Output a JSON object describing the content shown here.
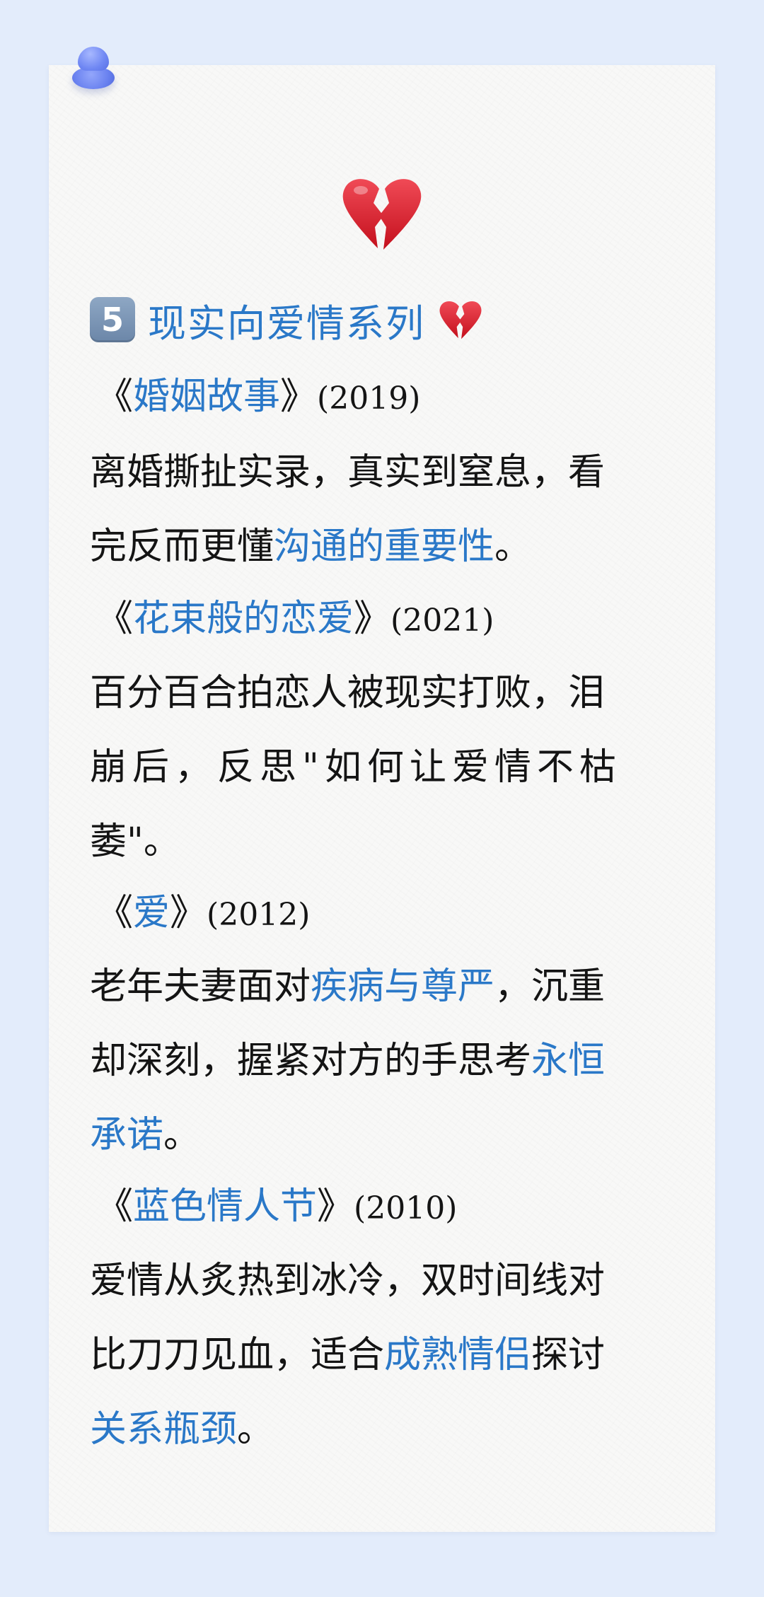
{
  "heading": {
    "number_badge": "5",
    "text": "现实向爱情系列",
    "emoji": "broken-heart"
  },
  "big_emoji": "broken-heart",
  "colors": {
    "background": "#e3ecfb",
    "card": "#f8f8f7",
    "highlight": "#2a78c8",
    "text": "#141414",
    "heart": "#e0202c"
  },
  "movies": [
    {
      "open_quote": "《",
      "title": "婚姻故事",
      "close_quote": "》",
      "year": "(2019)",
      "lines": [
        [
          {
            "t": "离婚撕扯实录，真实到窒息，看",
            "hl": false
          }
        ],
        [
          {
            "t": "完反而更懂",
            "hl": false
          },
          {
            "t": "沟通的重要性",
            "hl": true
          },
          {
            "t": "。",
            "hl": false
          }
        ]
      ]
    },
    {
      "open_quote": "《",
      "title": "花束般的恋爱",
      "close_quote": "》",
      "year": "(2021)",
      "lines": [
        [
          {
            "t": "百分百合拍恋人被现实打败，泪",
            "hl": false
          }
        ],
        [
          {
            "t": "崩后，反思\"如何让爱情不枯",
            "hl": false
          }
        ],
        [
          {
            "t": "萎\"。",
            "hl": false
          }
        ]
      ]
    },
    {
      "open_quote": "《",
      "title": "爱",
      "close_quote": "》",
      "year": "(2012)",
      "lines": [
        [
          {
            "t": "老年夫妻面对",
            "hl": false
          },
          {
            "t": "疾病与尊严",
            "hl": true
          },
          {
            "t": "，沉重",
            "hl": false
          }
        ],
        [
          {
            "t": "却深刻，握紧对方的手思考",
            "hl": false
          },
          {
            "t": "永恒",
            "hl": true
          }
        ],
        [
          {
            "t": "承诺",
            "hl": true
          },
          {
            "t": "。",
            "hl": false
          }
        ]
      ]
    },
    {
      "open_quote": "《",
      "title": "蓝色情人节",
      "close_quote": "》",
      "year": "(2010)",
      "lines": [
        [
          {
            "t": "爱情从炙热到冰冷，双时间线对",
            "hl": false
          }
        ],
        [
          {
            "t": "比刀刀见血，适合",
            "hl": false
          },
          {
            "t": "成熟情侣",
            "hl": true
          },
          {
            "t": "探讨",
            "hl": false
          }
        ],
        [
          {
            "t": "关系瓶颈",
            "hl": true
          },
          {
            "t": "。",
            "hl": false
          }
        ]
      ]
    }
  ]
}
